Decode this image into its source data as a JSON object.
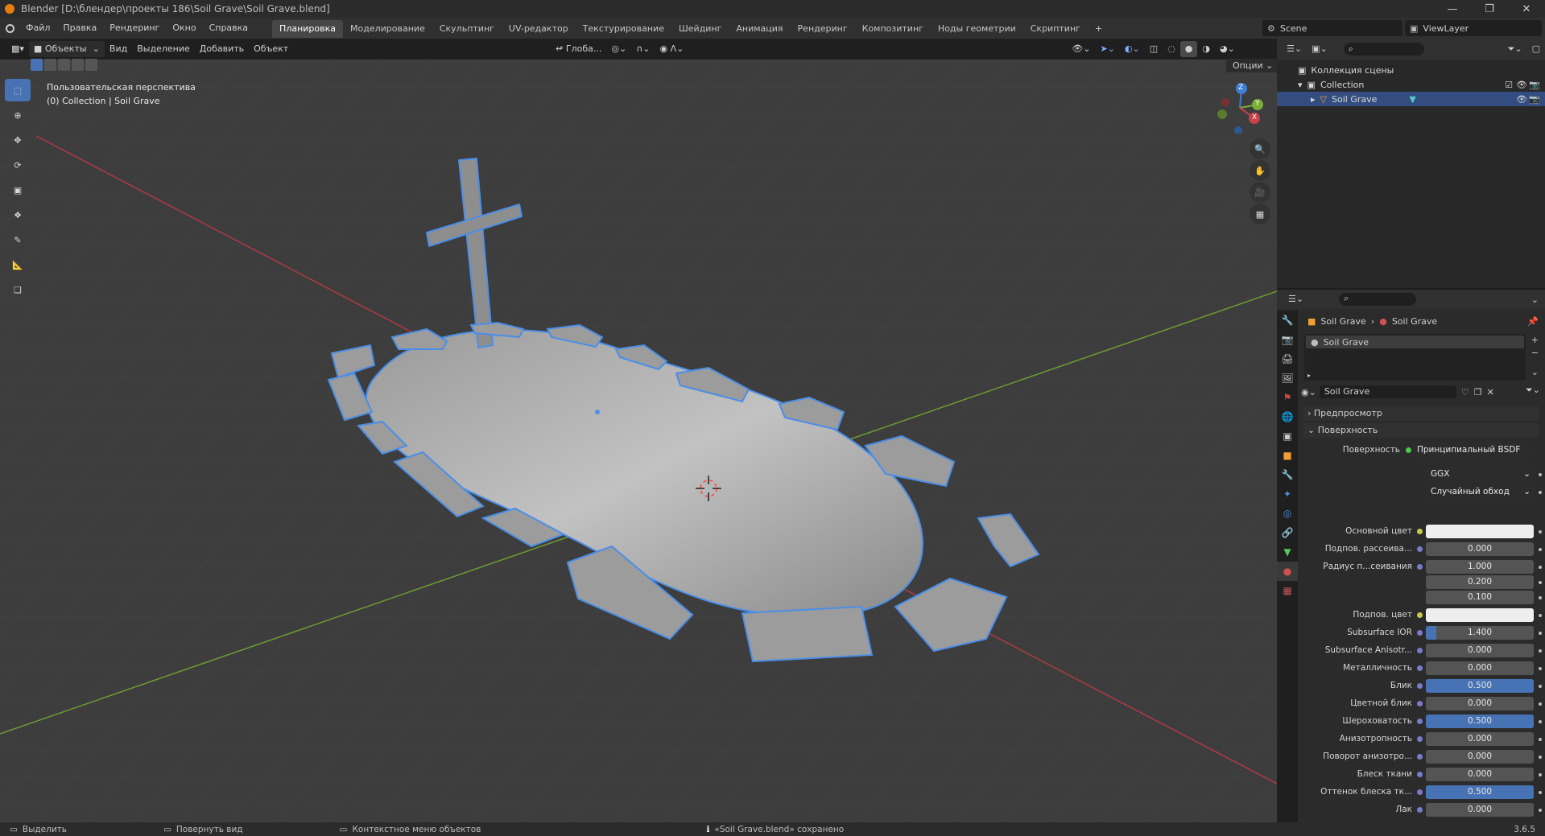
{
  "window": {
    "title": "Blender [D:\\блендер\\проекты 186\\Soil Grave\\Soil Grave.blend]",
    "controls": [
      "minimize-icon",
      "restore-icon",
      "close-icon"
    ]
  },
  "menu": {
    "items": [
      "Файл",
      "Правка",
      "Рендеринг",
      "Окно",
      "Справка"
    ],
    "workspaces": [
      "Планировка",
      "Моделирование",
      "Скульптинг",
      "UV-редактор",
      "Текстурирование",
      "Шейдинг",
      "Анимация",
      "Рендеринг",
      "Композитинг",
      "Ноды геометрии",
      "Скриптинг"
    ],
    "active_workspace": "Планировка",
    "add_tab": "+",
    "scene": "Scene",
    "view_layer": "ViewLayer"
  },
  "viewport_header": {
    "mode": "Объекты",
    "menus": [
      "Вид",
      "Выделение",
      "Добавить",
      "Объект"
    ],
    "transform_orientation": "Глоба...",
    "options_label": "Опции"
  },
  "viewport": {
    "perspective": "Пользовательская перспектива",
    "context": "(0) Collection | Soil Grave",
    "gizmo_axes": [
      "X",
      "Y",
      "Z"
    ],
    "colors": {
      "x_axis": "#c9414a",
      "y_axis": "#7aad3a",
      "z_axis": "#3e7fd4",
      "outline": "#4a8ee8",
      "grid_bg": "#3d3d3d"
    }
  },
  "toolbar": {
    "tools": [
      "select-box-icon",
      "cursor-icon",
      "move-icon",
      "rotate-icon",
      "scale-icon",
      "transform-icon",
      "annotate-icon",
      "measure-icon",
      "add-cube-icon"
    ]
  },
  "outliner": {
    "search_placeholder": "",
    "rows": [
      {
        "label": "Коллекция сцены",
        "indent": 0
      },
      {
        "label": "Collection",
        "indent": 1
      },
      {
        "label": "Soil Grave",
        "indent": 2,
        "selected": true
      }
    ]
  },
  "properties": {
    "breadcrumb": [
      "Soil Grave",
      "Soil Grave"
    ],
    "material_slot": "Soil Grave",
    "material_name": "Soil Grave",
    "panels": {
      "preview": "Предпросмотр",
      "surface": "Поверхность"
    },
    "surface_label": "Поверхность",
    "surface_value": "Принципиальный BSDF",
    "distribution": "GGX",
    "subsurface_method": "Случайный обход",
    "fields": [
      {
        "label": "Основной цвет",
        "type": "color",
        "color": "#eeeeee"
      },
      {
        "label": "Подпов. рассеива...",
        "value": "0.000",
        "fill": 0
      },
      {
        "label": "Радиус п...сеивания",
        "value": "1.000",
        "fill": 0
      },
      {
        "label": "",
        "value": "0.200",
        "fill": 0
      },
      {
        "label": "",
        "value": "0.100",
        "fill": 0
      },
      {
        "label": "Подпов. цвет",
        "type": "color",
        "color": "#eeeeee"
      },
      {
        "label": "Subsurface IOR",
        "value": "1.400",
        "fill": 0.1
      },
      {
        "label": "Subsurface Anisotr...",
        "value": "0.000",
        "fill": 0
      },
      {
        "label": "Металличность",
        "value": "0.000",
        "fill": 0
      },
      {
        "label": "Блик",
        "value": "0.500",
        "fill": 1.0
      },
      {
        "label": "Цветной блик",
        "value": "0.000",
        "fill": 0
      },
      {
        "label": "Шероховатость",
        "value": "0.500",
        "fill": 1.0
      },
      {
        "label": "Анизотропность",
        "value": "0.000",
        "fill": 0
      },
      {
        "label": "Поворот анизотро...",
        "value": "0.000",
        "fill": 0
      },
      {
        "label": "Блеск ткани",
        "value": "0.000",
        "fill": 0
      },
      {
        "label": "Оттенок блеска тк...",
        "value": "0.500",
        "fill": 1.0
      },
      {
        "label": "Лак",
        "value": "0.000",
        "fill": 0
      }
    ]
  },
  "statusbar": {
    "select": "Выделить",
    "rotate": "Повернуть вид",
    "context_menu": "Контекстное меню объектов",
    "message": "«Soil Grave.blend» сохранено",
    "version": "3.6.5"
  }
}
